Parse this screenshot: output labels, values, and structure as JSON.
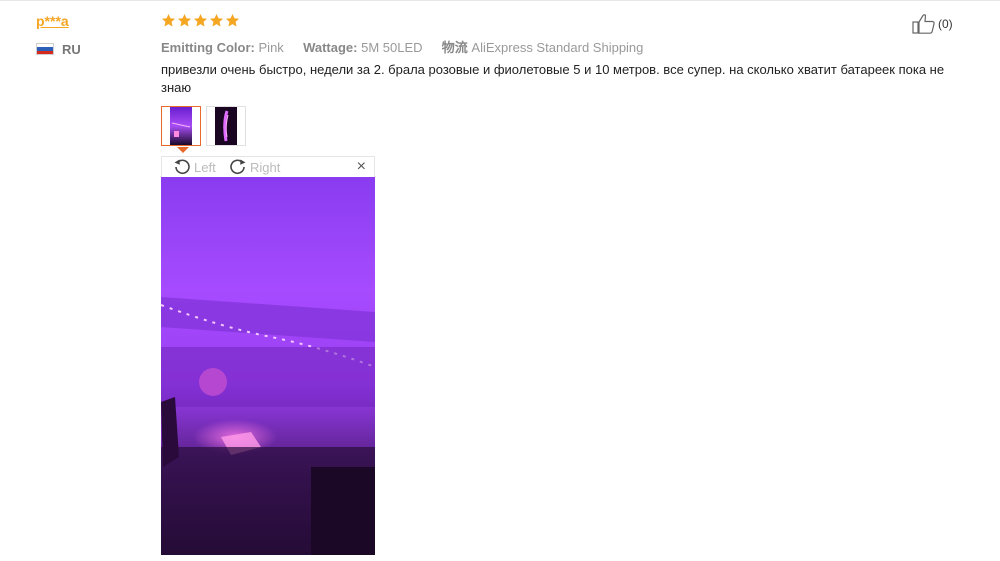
{
  "review": {
    "user_name": "p***a",
    "country_code": "RU",
    "flag_colors": [
      "#ffffff",
      "#2c5fb8",
      "#d52b1e"
    ],
    "rating": 5,
    "star_color": "#f5a623",
    "meta": {
      "color_label": "Emitting Color:",
      "color_value": "Pink",
      "wattage_label": "Wattage:",
      "wattage_value": "5M 50LED",
      "shipping_label": "物流",
      "shipping_value": "AliExpress Standard Shipping"
    },
    "helpful_count": "(0)",
    "text": "привезли очень быстро, недели за 2. брала розовые и фиолетовые 5 и 10 метров. все супер. на сколько хватит батареек пока не знаю",
    "thumbnails": [
      {
        "icon": "photo-thumbnail",
        "active": true
      },
      {
        "icon": "photo-thumbnail",
        "active": false
      }
    ]
  },
  "viewer": {
    "rotate_left_label": "Left",
    "rotate_right_label": "Right",
    "close_symbol": "×"
  },
  "colors": {
    "accent": "#e86a2a",
    "purple_light": "#a64bff"
  }
}
